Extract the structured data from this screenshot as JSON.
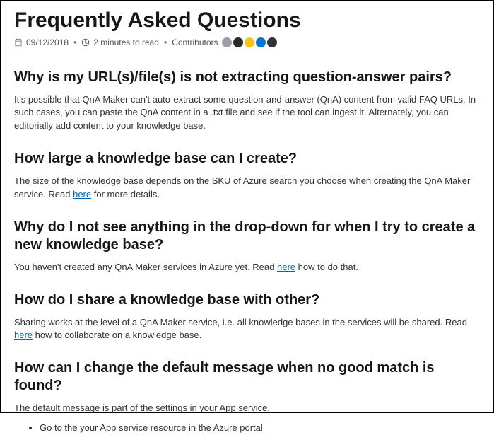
{
  "title": "Frequently Asked Questions",
  "meta": {
    "date": "09/12/2018",
    "read_time": "2 minutes to read",
    "contributors_label": "Contributors"
  },
  "avatars": [
    {
      "bg": "#9aa0a6"
    },
    {
      "bg": "#2b2b2b"
    },
    {
      "bg": "#f5c518"
    },
    {
      "bg": "#0078d4"
    },
    {
      "bg": "#333333"
    }
  ],
  "sections": [
    {
      "heading": "Why is my URL(s)/file(s) is not extracting question-answer pairs?",
      "body": "It's possible that QnA Maker can't auto-extract some question-and-answer (QnA) content from valid FAQ URLs. In such cases, you can paste the QnA content in a .txt file and see if the tool can ingest it. Alternately, you can editorially add content to your knowledge base."
    },
    {
      "heading": "How large a knowledge base can I create?",
      "body_pre": "The size of the knowledge base depends on the SKU of Azure search you choose when creating the QnA Maker service. Read ",
      "link": "here",
      "body_post": " for more details."
    },
    {
      "heading": "Why do I not see anything in the drop-down for when I try to create a new knowledge base?",
      "body_pre": "You haven't created any QnA Maker services in Azure yet. Read ",
      "link": "here",
      "body_post": " how to do that."
    },
    {
      "heading": "How do I share a knowledge base with other?",
      "body_pre": "Sharing works at the level of a QnA Maker service, i.e. all knowledge bases in the services will be shared. Read ",
      "link": "here",
      "body_post": " how to collaborate on a knowledge base."
    },
    {
      "heading": "How can I change the default message when no good match is found?",
      "body": "The default message is part of the settings in your App service.",
      "bullets": [
        "Go to the your App service resource in the Azure portal"
      ]
    }
  ]
}
